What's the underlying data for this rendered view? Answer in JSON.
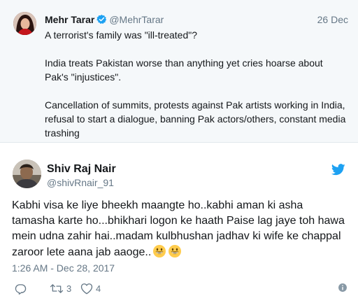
{
  "parent_tweet": {
    "author_name": "Mehr Tarar",
    "verified": true,
    "handle": "@MehrTarar",
    "date": "26 Dec",
    "paragraphs": [
      "A terrorist's family was \"ill-treated\"?",
      "India treats Pakistan worse than anything yet cries hoarse about Pak's \"injustices\".",
      "Cancellation of summits, protests against Pak artists working in India, refusal to start a dialogue, banning Pak actors/others, constant media trashing"
    ]
  },
  "tweet": {
    "author_name": "Shiv Raj Nair",
    "handle": "@shivRnair_91",
    "text": "Kabhi visa ke liye bheekh maangte ho..kabhi aman ki asha tamasha karte ho...bhikhari logon ke haath Paise lag jaye toh hawa mein udna zahir hai..madam kulbhushan jadhav ki wife ke chappal zaroor lete aana jab aaoge..",
    "emojis": [
      "grinning-face-icon",
      "grinning-face-icon"
    ],
    "timestamp": "1:26 AM - Dec 28, 2017",
    "retweet_count": "3",
    "like_count": "4"
  },
  "colors": {
    "twitter_blue": "#1da1f2",
    "verified_blue": "#1da1f2",
    "secondary_text": "#657786",
    "parent_background": "#f5f8fa"
  }
}
